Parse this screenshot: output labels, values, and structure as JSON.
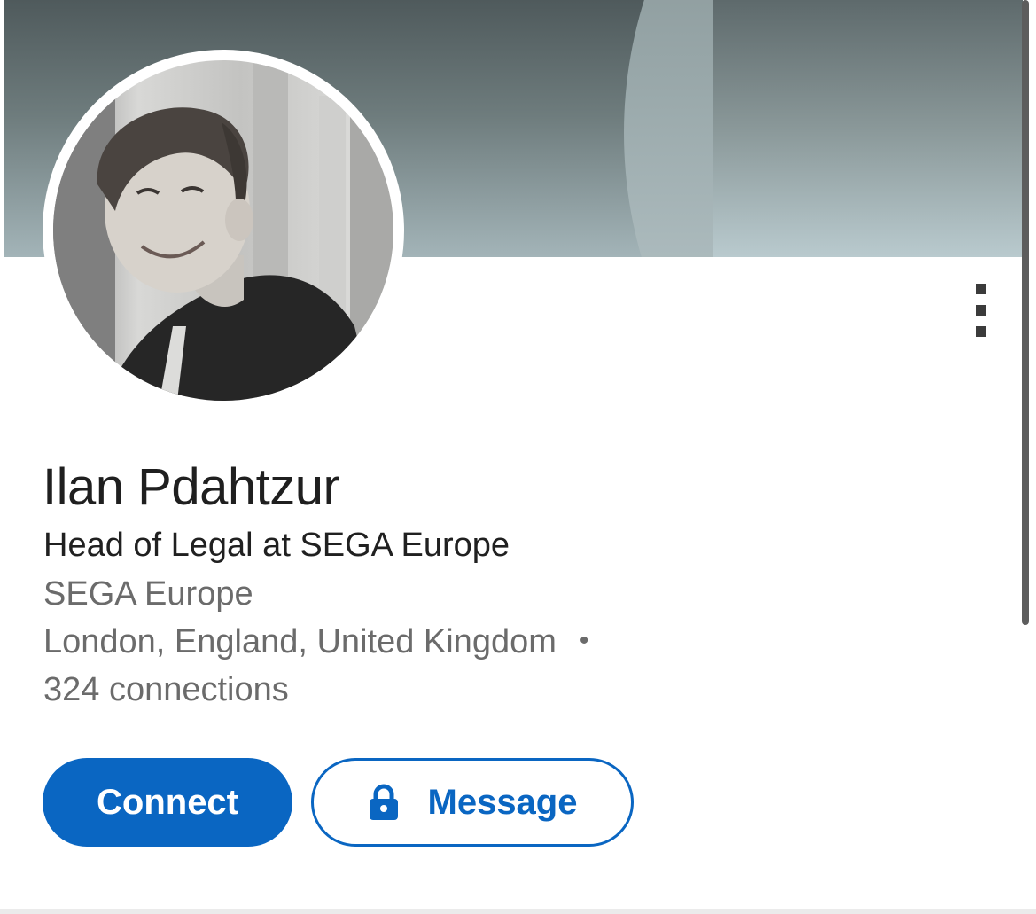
{
  "profile": {
    "name": "Ilan Pdahtzur",
    "headline": "Head of Legal at SEGA Europe",
    "company": "SEGA Europe",
    "location": "London, England, United Kingdom",
    "separator": "•",
    "connections": "324 connections"
  },
  "actions": {
    "connect_label": "Connect",
    "message_label": "Message"
  },
  "icons": {
    "more": "more-vertical-icon",
    "lock": "lock-icon"
  },
  "colors": {
    "accent": "#0a66c2",
    "name_text": "#1f1f1f",
    "secondary_text": "#6b6b6b"
  }
}
